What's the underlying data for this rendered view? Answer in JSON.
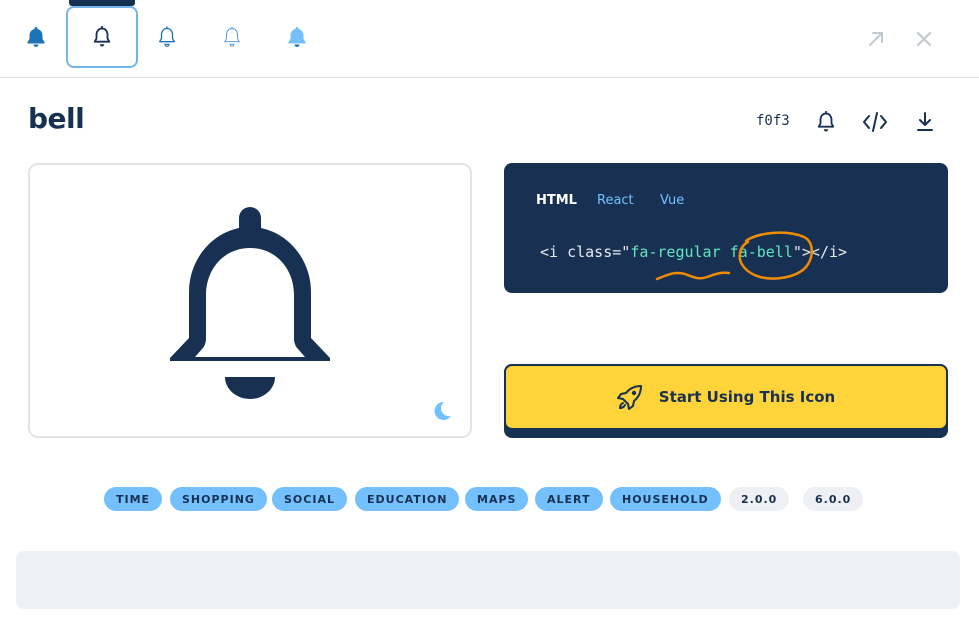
{
  "top_bar": {
    "style_buttons": [
      {
        "name": "solid",
        "active": false
      },
      {
        "name": "regular",
        "active": true
      },
      {
        "name": "light",
        "active": false
      },
      {
        "name": "thin",
        "active": false
      },
      {
        "name": "duotone",
        "active": false
      }
    ]
  },
  "icon": {
    "name": "bell",
    "unicode": "f0f3"
  },
  "code": {
    "tabs": [
      "HTML",
      "React",
      "Vue"
    ],
    "active_tab": "HTML",
    "prefix": "<i class=\"",
    "class_part1": "fa-regular",
    "space": " ",
    "class_part2": "fa-bell",
    "suffix": "\"></i>"
  },
  "start_button": {
    "label": "Start Using This Icon"
  },
  "tags": [
    "TIME",
    "SHOPPING",
    "SOCIAL",
    "EDUCATION",
    "MAPS",
    "ALERT",
    "HOUSEHOLD"
  ],
  "versions": [
    "2.0.0",
    "6.0.0"
  ],
  "colors": {
    "navy": "#183153",
    "accent_blue": "#74c0fc",
    "yellow": "#ffd43b",
    "annotation_orange": "#f08c00",
    "code_green": "#63e6be"
  }
}
